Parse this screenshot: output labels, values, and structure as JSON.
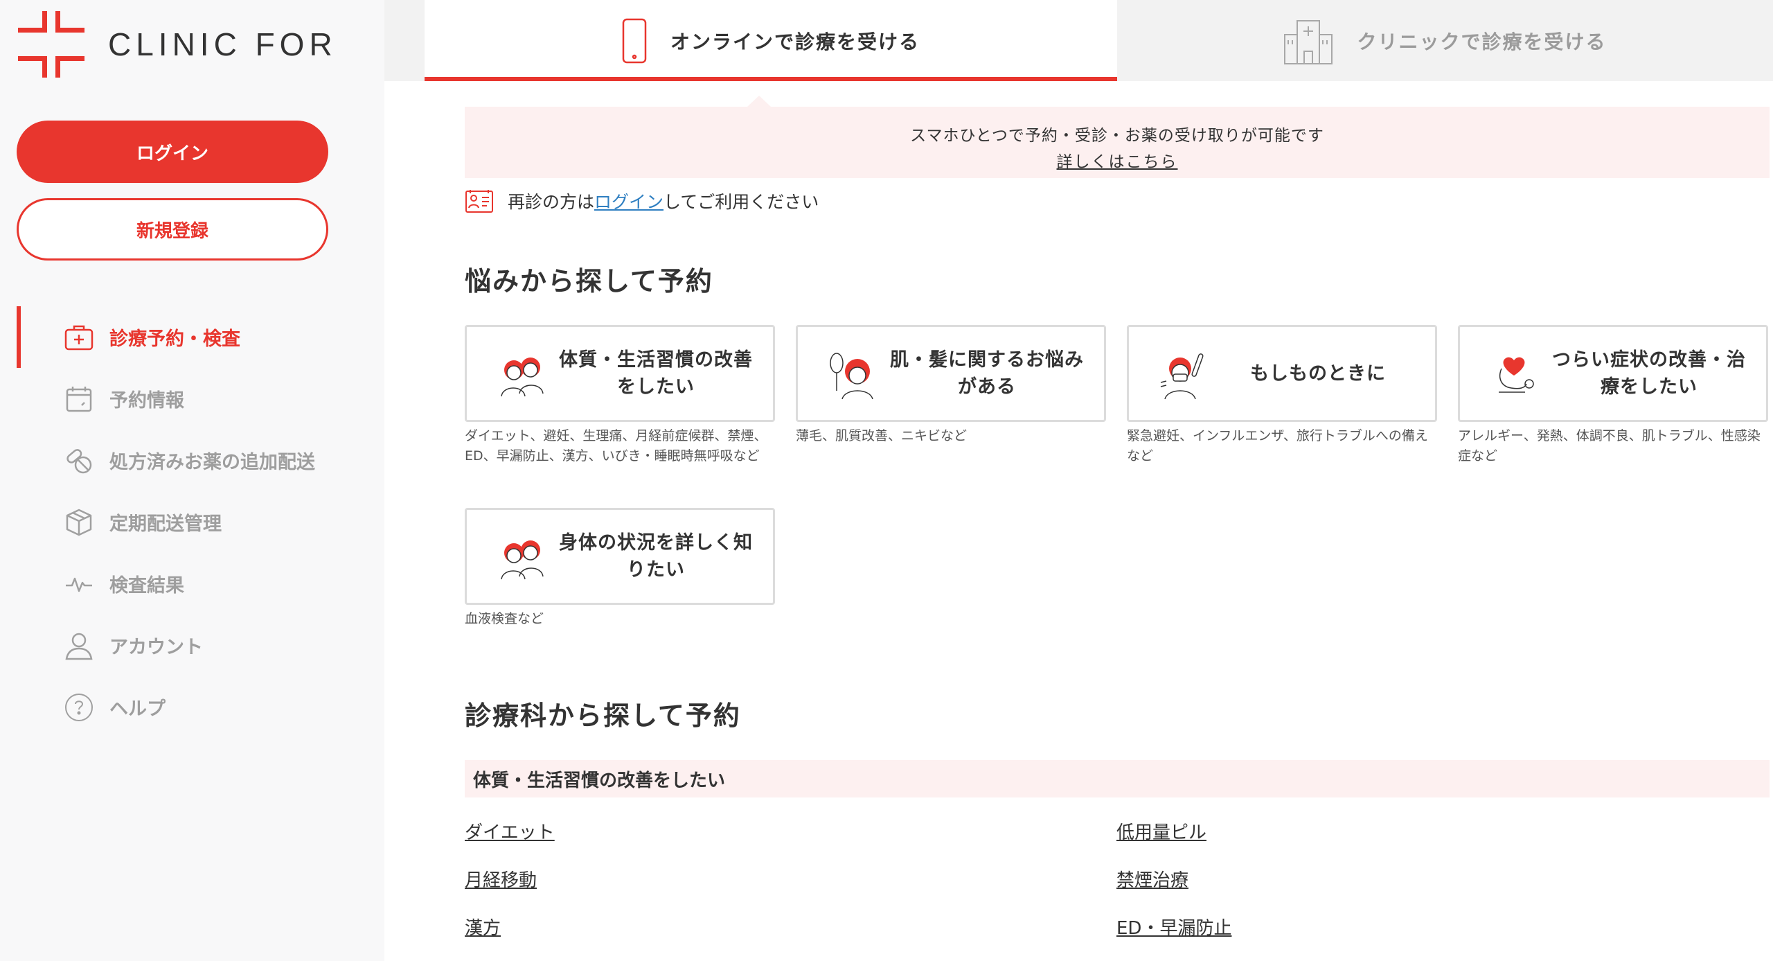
{
  "brand": {
    "name": "CLINIC FOR",
    "accent_color": "#e8362e"
  },
  "sidebar": {
    "login_label": "ログイン",
    "register_label": "新規登録",
    "nav": [
      {
        "label": "診療予約・検査",
        "icon": "medical-kit-icon",
        "active": true
      },
      {
        "label": "予約情報",
        "icon": "calendar-icon",
        "active": false
      },
      {
        "label": "処方済みお薬の追加配送",
        "icon": "pills-icon",
        "active": false
      },
      {
        "label": "定期配送管理",
        "icon": "box-icon",
        "active": false
      },
      {
        "label": "検査結果",
        "icon": "pulse-icon",
        "active": false
      },
      {
        "label": "アカウント",
        "icon": "user-icon",
        "active": false
      },
      {
        "label": "ヘルプ",
        "icon": "help-icon",
        "active": false
      }
    ]
  },
  "tabs": [
    {
      "label": "オンラインで診療を受ける",
      "icon": "smartphone-icon",
      "active": true
    },
    {
      "label": "クリニックで診療を受ける",
      "icon": "hospital-icon",
      "active": false
    }
  ],
  "notice": {
    "text": "スマホひとつで予約・受診・お薬の受け取りが可能です",
    "link": "詳しくはこちら"
  },
  "revisit": {
    "prefix": "再診の方は",
    "link": "ログイン",
    "suffix": "してご利用ください"
  },
  "concerns": {
    "title": "悩みから探して予約",
    "cards": [
      {
        "title": "体質・生活習慣の改善をしたい",
        "desc": "ダイエット、避妊、生理痛、月経前症候群、禁煙、ED、早漏防止、漢方、いびき・睡眠時無呼吸など",
        "illustration": "two-people-icon"
      },
      {
        "title": "肌・髪に関するお悩みがある",
        "desc": "薄毛、肌質改善、ニキビなど",
        "illustration": "hair-mirror-icon"
      },
      {
        "title": "もしものときに",
        "desc": "緊急避妊、インフルエンザ、旅行トラブルへの備えなど",
        "illustration": "mask-thermometer-icon"
      },
      {
        "title": "つらい症状の改善・治療をしたい",
        "desc": "アレルギー、発熱、体調不良、肌トラブル、性感染症など",
        "illustration": "stethoscope-heart-icon"
      },
      {
        "title": "身体の状況を詳しく知りたい",
        "desc": "血液検査など",
        "illustration": "two-people-icon"
      }
    ]
  },
  "departments": {
    "title": "診療科から探して予約",
    "group_title": "体質・生活習慣の改善をしたい",
    "links": [
      "ダイエット",
      "低用量ピル",
      "月経移動",
      "禁煙治療",
      "漢方",
      "ED・早漏防止"
    ]
  }
}
